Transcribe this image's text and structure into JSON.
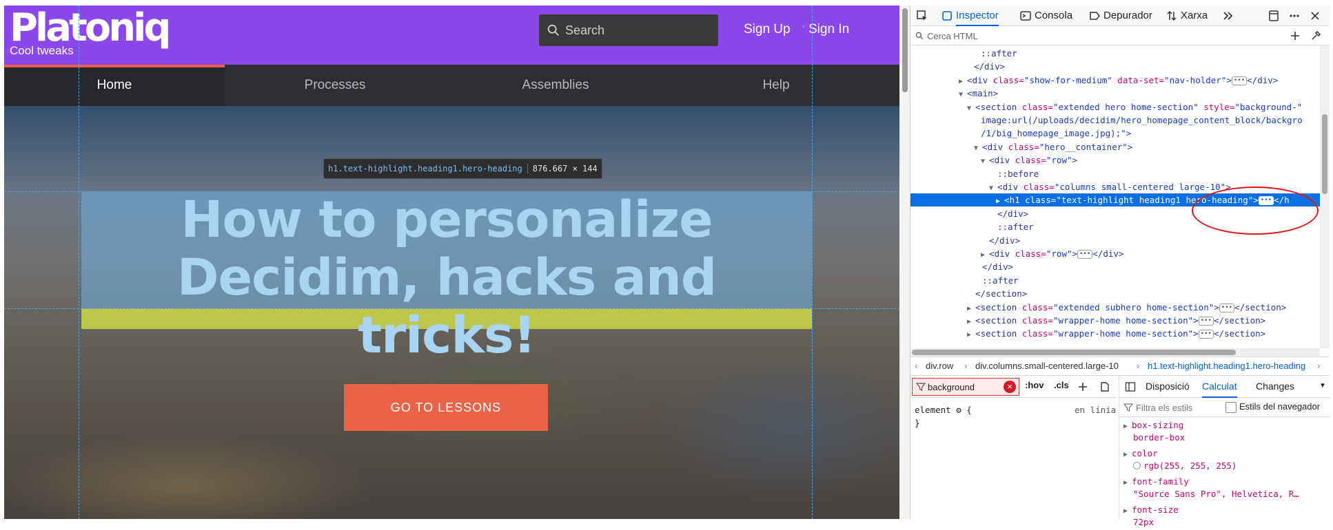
{
  "site": {
    "logo_text": "Platoniq",
    "tagline": "Cool tweaks",
    "search_placeholder": "Search",
    "sign_up": "Sign Up",
    "auth_separator": "·",
    "sign_in": "Sign In",
    "nav": [
      {
        "label": "Home",
        "active": true
      },
      {
        "label": "Processes",
        "active": false
      },
      {
        "label": "Assemblies",
        "active": false
      },
      {
        "label": "Help",
        "active": false
      }
    ],
    "hero_heading_line1": "How to personalize",
    "hero_heading_line2": "Decidim, hacks and tricks!",
    "cta_label": "GO TO LESSONS",
    "tooltip_selector": "h1.text-highlight.heading1.hero-heading",
    "tooltip_dims": "876.667 × 144"
  },
  "devtools": {
    "tabs": [
      {
        "label": "Inspector",
        "icon": "box-icon",
        "active": true
      },
      {
        "label": "Consola",
        "icon": "console-icon",
        "active": false
      },
      {
        "label": "Depurador",
        "icon": "debugger-icon",
        "active": false
      },
      {
        "label": "Xarxa",
        "icon": "network-icon",
        "active": false
      }
    ],
    "search_html_placeholder": "Cerca HTML",
    "markup_lines": [
      {
        "text": "::after",
        "kind": "pseudo"
      },
      {
        "text": "</div>",
        "kind": "close"
      },
      {
        "open": "<div",
        "attrs": [
          {
            "n": "class",
            "v": "show-for-medium"
          },
          {
            "n": "data-set",
            "v": "nav-holder"
          }
        ],
        "tail": "></div>",
        "twisty": "▶"
      },
      {
        "open": "<main>",
        "attrs": [],
        "tail": "",
        "twisty": "▼"
      },
      {
        "open": "<section",
        "attrs": [
          {
            "n": "class",
            "v": "extended hero home-section"
          },
          {
            "n": "style",
            "v": "background-"
          }
        ],
        "tail": "",
        "twisty": "▼"
      },
      {
        "text": "image:url(/uploads/decidim/hero_homepage_content_block/backgro",
        "kind": "cont"
      },
      {
        "text": "/1/big_homepage_image.jpg);\">",
        "kind": "cont"
      },
      {
        "open": "<div",
        "attrs": [
          {
            "n": "class",
            "v": "hero__container"
          }
        ],
        "tail": ">",
        "twisty": "▼"
      },
      {
        "open": "<div",
        "attrs": [
          {
            "n": "class",
            "v": "row"
          }
        ],
        "tail": ">",
        "twisty": "▼"
      },
      {
        "text": "::before",
        "kind": "pseudo"
      },
      {
        "open": "<div",
        "attrs": [
          {
            "n": "class",
            "v": "columns small-centered large-10"
          }
        ],
        "tail": ">",
        "twisty": "▼"
      },
      {
        "open": "<h1",
        "attrs": [
          {
            "n": "class",
            "v": "text-highlight heading1 hero-heading"
          }
        ],
        "tail": ">",
        "twisty": "▶",
        "selected": true,
        "after": "</h"
      },
      {
        "text": "</div>",
        "kind": "close"
      },
      {
        "text": "::after",
        "kind": "pseudo"
      },
      {
        "text": "</div>",
        "kind": "close"
      },
      {
        "open": "<div",
        "attrs": [
          {
            "n": "class",
            "v": "row"
          }
        ],
        "tail": "></div>",
        "twisty": "▶"
      },
      {
        "text": "</div>",
        "kind": "close"
      },
      {
        "text": "::after",
        "kind": "pseudo"
      },
      {
        "text": "</section>",
        "kind": "close"
      },
      {
        "open": "<section",
        "attrs": [
          {
            "n": "class",
            "v": "extended subhero home-section"
          }
        ],
        "tail": "></section>",
        "twisty": "▶"
      },
      {
        "open": "<section",
        "attrs": [
          {
            "n": "class",
            "v": "wrapper-home home-section"
          }
        ],
        "tail": "></section>",
        "twisty": "▶"
      },
      {
        "open": "<section",
        "attrs": [
          {
            "n": "class",
            "v": "wrapper-home home-section"
          }
        ],
        "tail": "></section>",
        "twisty": "▶"
      }
    ],
    "breadcrumbs": [
      "div.row",
      "div.columns.small-centered.large-10",
      "h1.text-highlight.heading1.hero-heading"
    ],
    "rules_filter_value": "background",
    "hov_label": ":hov",
    "cls_label": ".cls",
    "rule_selector": "element",
    "rule_open": "{",
    "rule_close": "}",
    "rule_source": "en línia",
    "computed_tabs": [
      {
        "label": "Disposició",
        "active": false
      },
      {
        "label": "Calculat",
        "active": true
      },
      {
        "label": "Changes",
        "active": false
      }
    ],
    "computed_filter_placeholder": "Filtra els estils",
    "browser_styles_label": "Estils del navegador",
    "computed_props": [
      {
        "name": "box-sizing",
        "value": "border-box",
        "swatch": false
      },
      {
        "name": "color",
        "value": "rgb(255, 255, 255)",
        "swatch": true
      },
      {
        "name": "font-family",
        "value": "\"Source Sans Pro\", Helvetica, R…",
        "swatch": false
      },
      {
        "name": "font-size",
        "value": "72px",
        "swatch": false
      }
    ]
  },
  "colors": {
    "brand_purple": "#8c47ea",
    "cta_orange": "#ea6248",
    "devtools_accent": "#0060df",
    "annotation_red": "#e01414"
  }
}
